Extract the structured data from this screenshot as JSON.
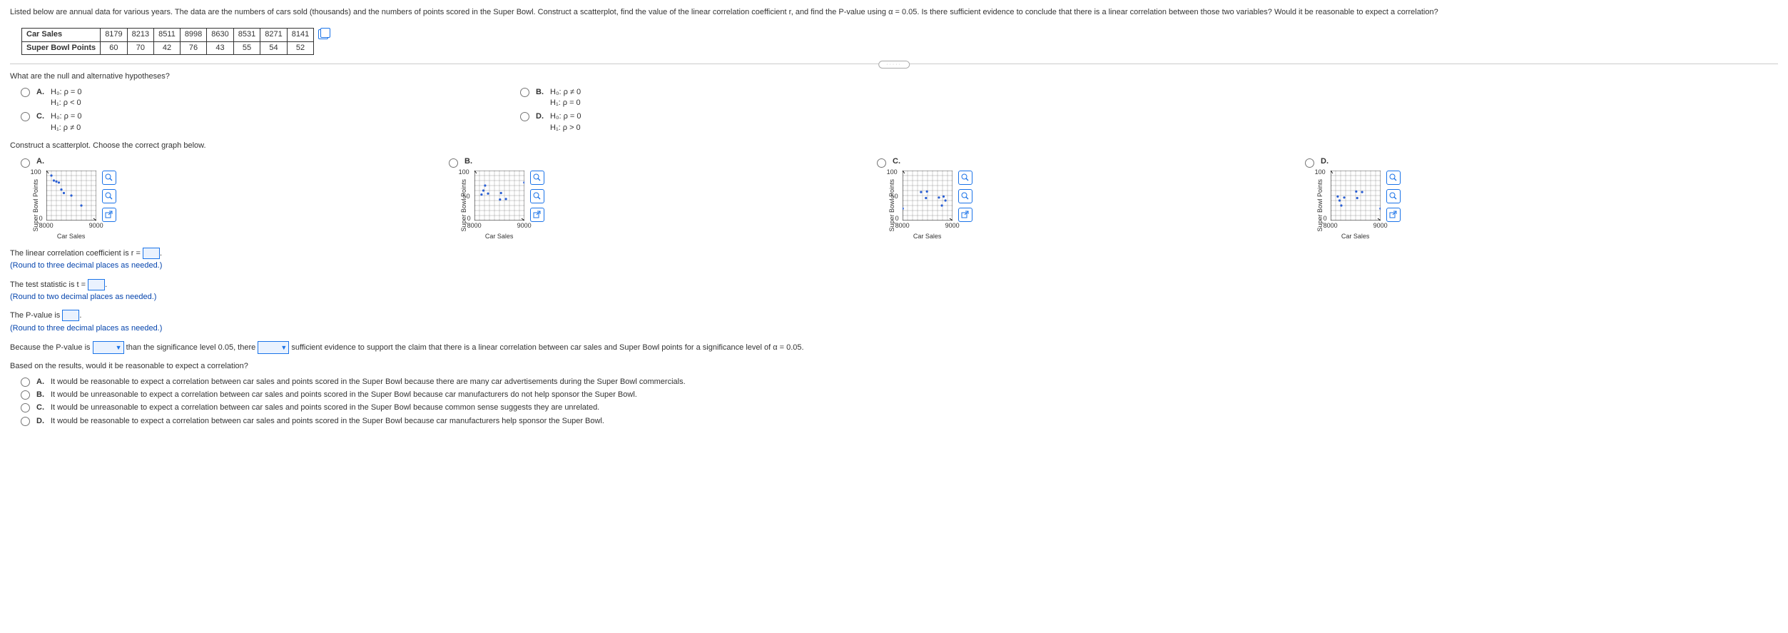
{
  "intro": "Listed below are annual data for various years. The data are the numbers of cars sold (thousands) and the numbers of points scored in the Super Bowl. Construct a scatterplot, find the value of the linear correlation coefficient r, and find the P-value using α = 0.05. Is there sufficient evidence to conclude that there is a linear correlation between those two variables? Would it be reasonable to expect a correlation?",
  "table": {
    "row1_label": "Car Sales",
    "row1": [
      "8179",
      "8213",
      "8511",
      "8998",
      "8630",
      "8531",
      "8271",
      "8141"
    ],
    "row2_label": "Super Bowl Points",
    "row2": [
      "60",
      "70",
      "42",
      "76",
      "43",
      "55",
      "54",
      "52"
    ]
  },
  "q_hyp": "What are the null and alternative hypotheses?",
  "hyp": {
    "A": {
      "letter": "A.",
      "l1": "H₀: ρ = 0",
      "l2": "H₁: ρ < 0"
    },
    "B": {
      "letter": "B.",
      "l1": "H₀: ρ ≠ 0",
      "l2": "H₁: ρ = 0"
    },
    "C": {
      "letter": "C.",
      "l1": "H₀: ρ = 0",
      "l2": "H₁: ρ ≠ 0"
    },
    "D": {
      "letter": "D.",
      "l1": "H₀: ρ = 0",
      "l2": "H₁: ρ > 0"
    }
  },
  "q_scatter": "Construct a scatterplot. Choose the correct graph below.",
  "axes": {
    "ylab": "Super Bowl Points",
    "xlab": "Car Sales",
    "y100": "100",
    "y50": "50",
    "y0": "0",
    "x0": "8000",
    "x1": "9000"
  },
  "letters": {
    "A": "A.",
    "B": "B.",
    "C": "C.",
    "D": "D."
  },
  "chart_data": [
    {
      "type": "scatter",
      "option": "A",
      "xlabel": "Car Sales",
      "ylabel": "Super Bowl Points",
      "xlim": [
        8000,
        9000
      ],
      "ylim": [
        0,
        100
      ],
      "points": [
        [
          8100,
          90
        ],
        [
          8150,
          80
        ],
        [
          8200,
          78
        ],
        [
          8250,
          76
        ],
        [
          8300,
          62
        ],
        [
          8350,
          55
        ],
        [
          8500,
          50
        ],
        [
          8700,
          30
        ]
      ]
    },
    {
      "type": "scatter",
      "option": "B",
      "xlabel": "Car Sales",
      "ylabel": "Super Bowl Points",
      "xlim": [
        8000,
        9000
      ],
      "ylim": [
        0,
        100
      ],
      "points": [
        [
          8179,
          60
        ],
        [
          8213,
          70
        ],
        [
          8511,
          42
        ],
        [
          8998,
          76
        ],
        [
          8630,
          43
        ],
        [
          8531,
          55
        ],
        [
          8271,
          54
        ],
        [
          8141,
          52
        ]
      ]
    },
    {
      "type": "scatter",
      "option": "C",
      "xlabel": "Car Sales",
      "ylabel": "Super Bowl Points",
      "xlim": [
        8000,
        9000
      ],
      "ylim": [
        0,
        100
      ],
      "points": [
        [
          8002,
          24
        ],
        [
          8370,
          57
        ],
        [
          8469,
          45
        ],
        [
          8489,
          58
        ],
        [
          8729,
          46
        ],
        [
          8787,
          30
        ],
        [
          8821,
          48
        ],
        [
          8859,
          40
        ]
      ]
    },
    {
      "type": "scatter",
      "option": "D",
      "xlabel": "Car Sales",
      "ylabel": "Super Bowl Points",
      "xlim": [
        8000,
        9000
      ],
      "ylim": [
        0,
        100
      ],
      "points": [
        [
          8179,
          40
        ],
        [
          8213,
          30
        ],
        [
          8511,
          58
        ],
        [
          8998,
          24
        ],
        [
          8630,
          57
        ],
        [
          8531,
          45
        ],
        [
          8271,
          46
        ],
        [
          8141,
          48
        ]
      ]
    }
  ],
  "r_line_a": "The linear correlation coefficient is r = ",
  "r_line_b": ".",
  "r_round": "(Round to three decimal places as needed.)",
  "t_line_a": "The test statistic is t = ",
  "t_line_b": ".",
  "t_round": "(Round to two decimal places as needed.)",
  "p_line_a": "The P-value is ",
  "p_line_b": ".",
  "p_round": "(Round to three decimal places as needed.)",
  "concl_a": "Because the P-value is ",
  "concl_b": " than the significance level 0.05, there ",
  "concl_c": " sufficient evidence to support the claim that there is a linear correlation between car sales and Super Bowl points for a significance level of α = 0.05.",
  "q_reason": "Based on the results, would it be reasonable to expect a correlation?",
  "reason": {
    "A": {
      "letter": "A.",
      "text": "It would be reasonable to expect a correlation between car sales and points scored in the Super Bowl because there are many car advertisements during the Super Bowl commercials."
    },
    "B": {
      "letter": "B.",
      "text": "It would be unreasonable to expect a correlation between car sales and points scored in the Super Bowl because car manufacturers do not help sponsor the Super Bowl."
    },
    "C": {
      "letter": "C.",
      "text": "It would be unreasonable to expect a correlation between car sales and points scored in the Super Bowl because common sense suggests they are unrelated."
    },
    "D": {
      "letter": "D.",
      "text": "It would be reasonable to expect a correlation between car sales and points scored in the Super Bowl because car manufacturers help sponsor the Super Bowl."
    }
  }
}
